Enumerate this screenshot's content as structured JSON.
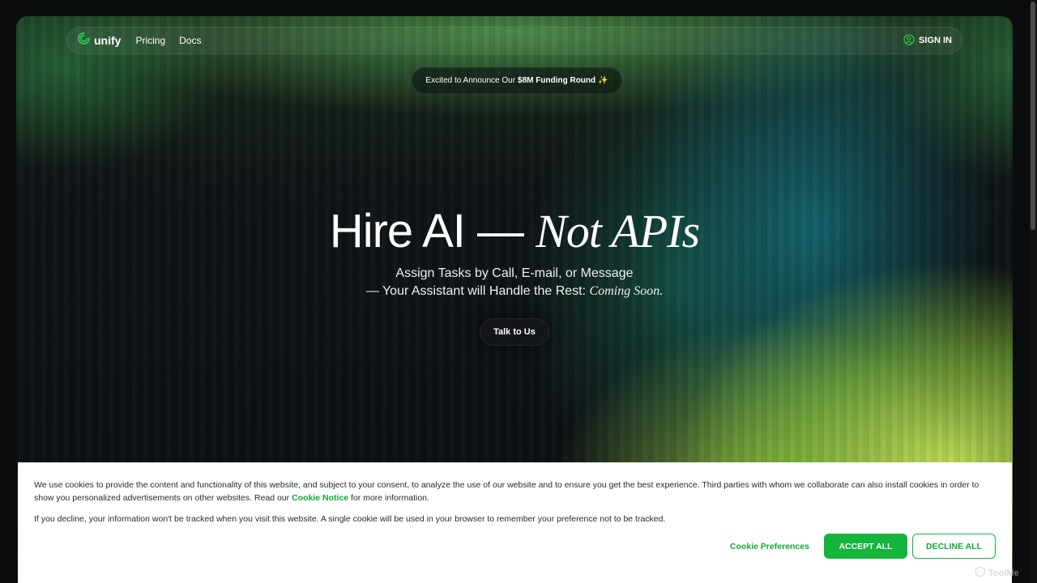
{
  "nav": {
    "logo_text": "unify",
    "links": [
      "Pricing",
      "Docs"
    ],
    "signin_label": "SIGN IN"
  },
  "announcement": {
    "prefix": "Excited to Announce Our",
    "highlight": "$8M Funding Round",
    "emoji": "✨"
  },
  "hero": {
    "headline_main": "Hire AI —",
    "headline_italic": "Not APIs",
    "sub_line1": "Assign Tasks by Call, E-mail, or Message",
    "sub_line2": "— Your Assistant will Handle the Rest:",
    "sub_line2_italic": "Coming Soon.",
    "cta_label": "Talk to Us"
  },
  "cookie_banner": {
    "para1_text": "We use cookies to provide the content and functionality of this website, and subject to your consent, to analyze the use of our website and to ensure you get the best experience. Third parties with whom we collaborate can also install cookies in order to show you personalized advertisements on other websites. Read our",
    "para1_link": "Cookie Notice",
    "para1_tail": "for more information.",
    "para2_text": "If you decline, your information won't be tracked when you visit this website. A single cookie will be used in your browser to remember your preference not to be tracked.",
    "preferences_label": "Cookie Preferences",
    "accept_label": "ACCEPT ALL",
    "decline_label": "DECLINE ALL"
  },
  "watermark": {
    "text": "ToolMe"
  },
  "colors": {
    "accent_green": "#13b53a",
    "link_green": "#13a83a"
  }
}
